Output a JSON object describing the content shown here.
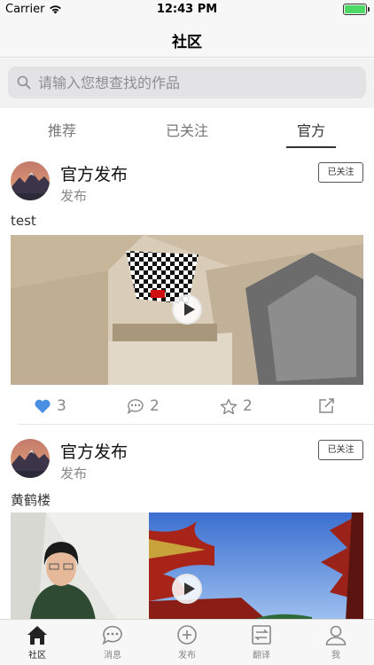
{
  "status_bar": {
    "carrier": "Carrier",
    "time": "12:43 PM"
  },
  "nav": {
    "title": "社区"
  },
  "search": {
    "placeholder": "请输入您想查找的作品"
  },
  "tabs": [
    {
      "label": "推荐",
      "active": false
    },
    {
      "label": "已关注",
      "active": false
    },
    {
      "label": "官方",
      "active": true
    }
  ],
  "posts": [
    {
      "author": "官方发布",
      "subtitle": "发布",
      "follow_label": "已关注",
      "text": "test",
      "likes": "3",
      "comments": "2",
      "favorites": "2"
    },
    {
      "author": "官方发布",
      "subtitle": "发布",
      "follow_label": "已关注",
      "text": "黄鹤楼"
    }
  ],
  "tabbar": [
    {
      "label": "社区",
      "icon": "home-icon",
      "active": true
    },
    {
      "label": "消息",
      "icon": "chat-bubble-icon",
      "active": false
    },
    {
      "label": "发布",
      "icon": "plus-circle-icon",
      "active": false
    },
    {
      "label": "翻译",
      "icon": "translate-icon",
      "active": false
    },
    {
      "label": "我",
      "icon": "user-icon",
      "active": false
    }
  ],
  "colors": {
    "accent_like": "#4a90e2",
    "battery": "#4cd964"
  }
}
